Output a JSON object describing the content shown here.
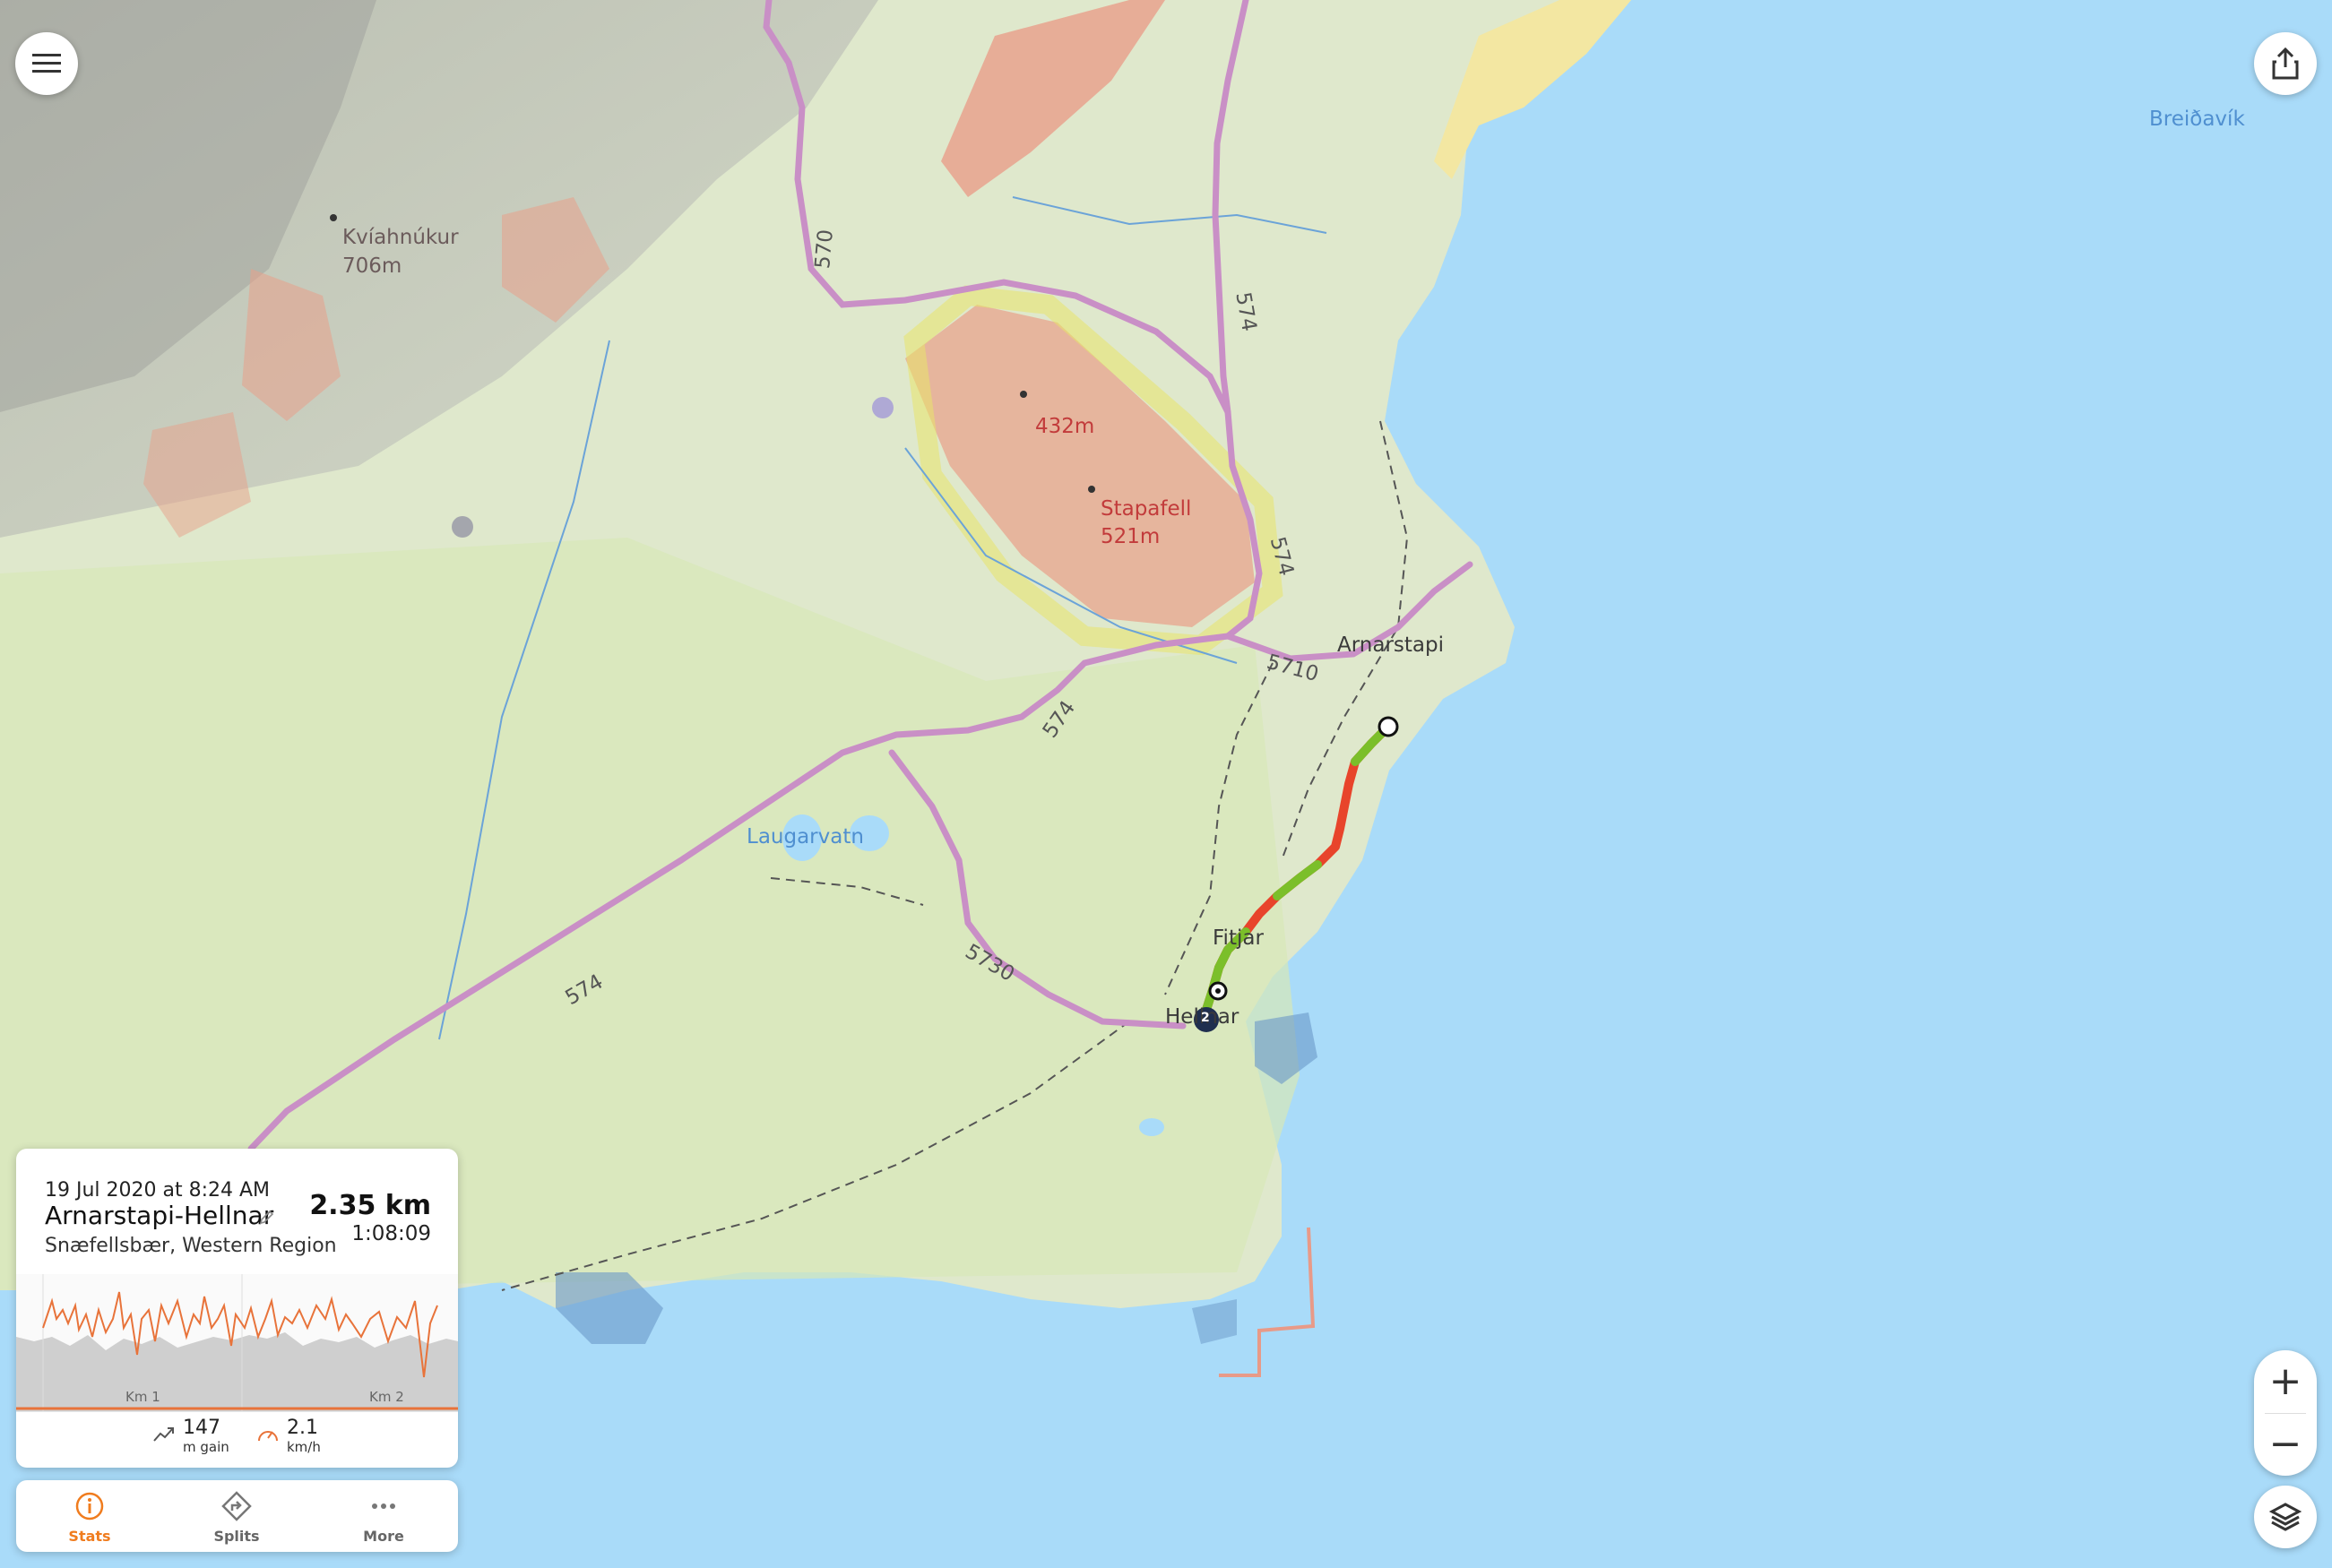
{
  "map": {
    "colors": {
      "sea": "#a9dbf9",
      "land": "#d9e6c2",
      "road": "#c98fc6",
      "route_fast": "#7bbf2a",
      "route_slow": "#e8442b"
    },
    "labels": {
      "breidavik": "Breiðavík",
      "kviahnukur": "Kvíahnúkur",
      "kviahnukur_elev": "706m",
      "peak432": "432m",
      "stapafell": "Stapafell",
      "stapafell_elev": "521m",
      "arnarstapi": "Arnarstapi",
      "laugarvatn": "Laugarvatn",
      "fitjar": "Fitjar",
      "hellnar": "Hellnar",
      "road_570": "570",
      "road_574_a": "574",
      "road_574_b": "574",
      "road_574_c": "574",
      "road_574_d": "574",
      "road_5710": "5710",
      "road_5730": "5730",
      "marker_2": "2"
    }
  },
  "controls": {
    "menu_icon": "menu-icon",
    "share_icon": "share-icon",
    "zoom_in": "+",
    "zoom_out": "−",
    "layers_icon": "layers-icon"
  },
  "activity": {
    "date": "19 Jul 2020 at 8:24 AM",
    "title": "Arnarstapi-Hellnar",
    "region": "Snæfellsbær, Western Region",
    "distance": "2.35 km",
    "duration": "1:08:09",
    "chart": {
      "km_labels": [
        "Km 1",
        "Km 2"
      ]
    },
    "stats": {
      "gain_value": "147",
      "gain_unit": "m gain",
      "speed_value": "2.1",
      "speed_unit": "km/h"
    }
  },
  "tabs": [
    {
      "label": "Stats",
      "icon": "info-icon"
    },
    {
      "label": "Splits",
      "icon": "splits-icon"
    },
    {
      "label": "More",
      "icon": "more-icon"
    }
  ]
}
